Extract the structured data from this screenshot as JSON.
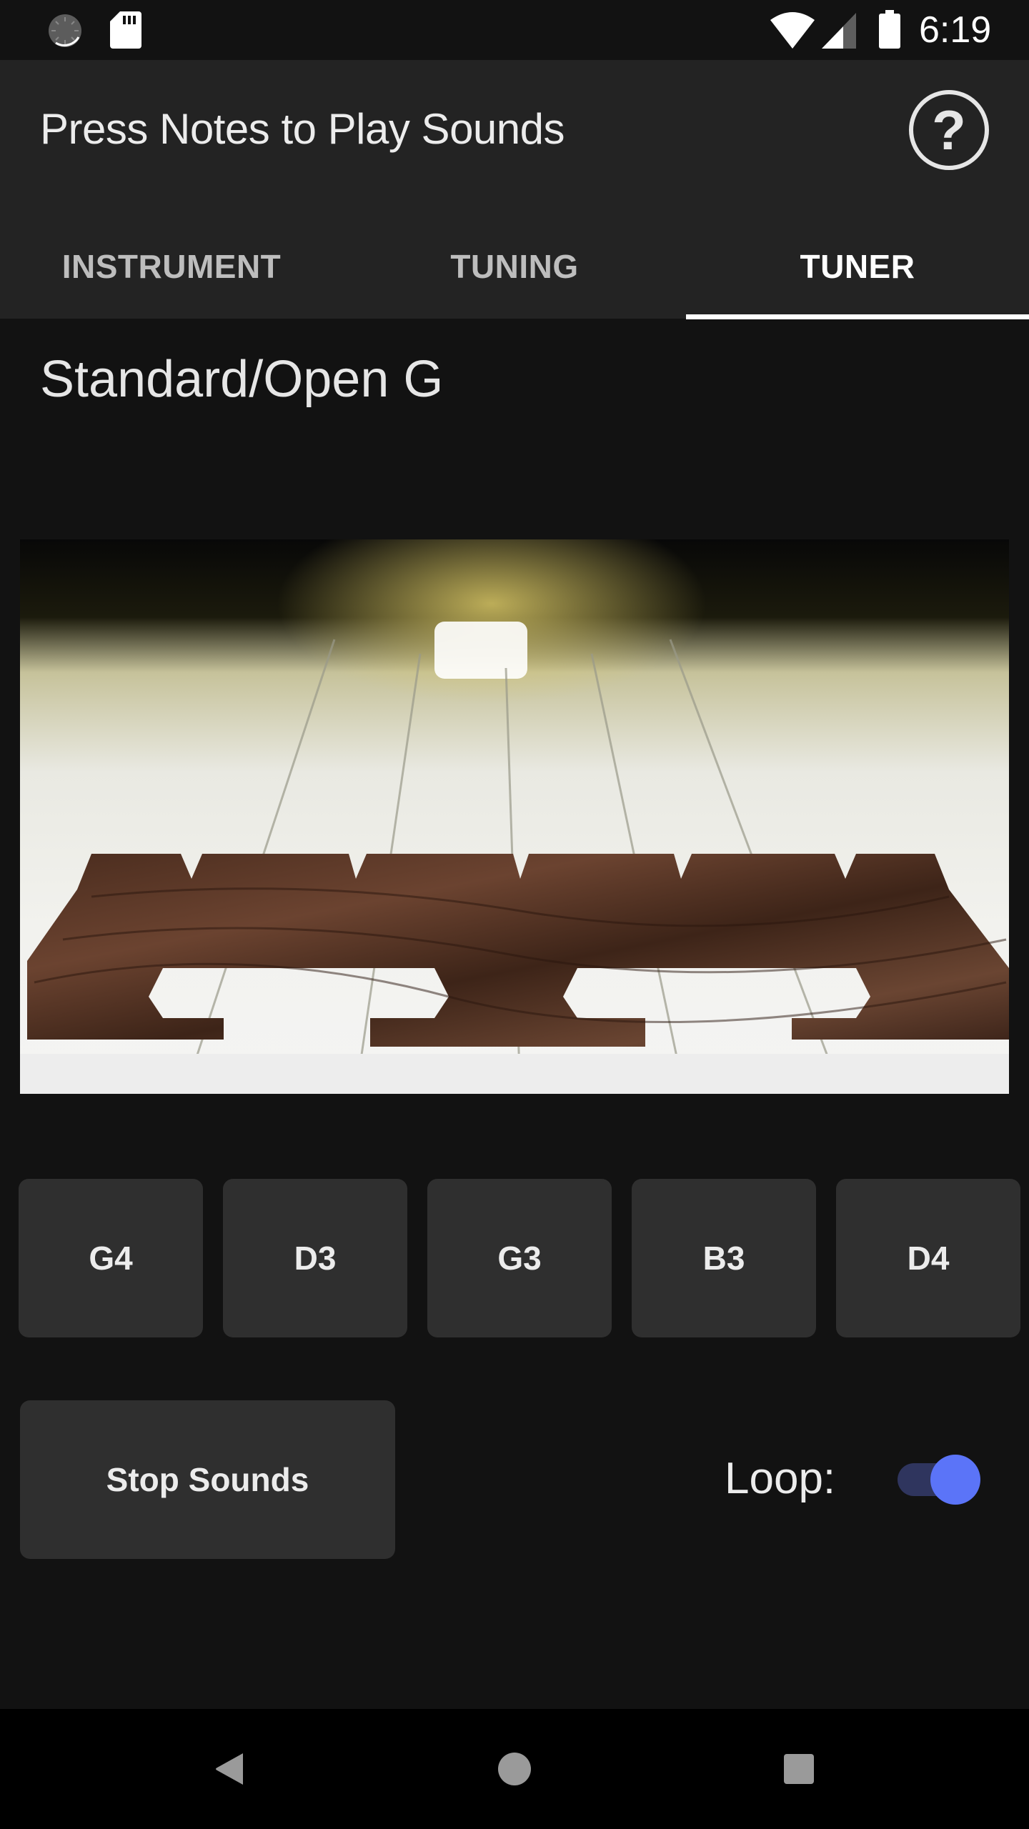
{
  "status_bar": {
    "time": "6:19",
    "left_icons": [
      "sync-progress-icon",
      "sd-card-icon"
    ],
    "right_icons": [
      "wifi-icon",
      "cell-signal-icon",
      "battery-icon"
    ]
  },
  "app_bar": {
    "title": "Press Notes to Play Sounds",
    "help_icon": "help-circle-icon",
    "help_glyph": "?"
  },
  "tabs": [
    {
      "label": "INSTRUMENT",
      "active": false
    },
    {
      "label": "TUNING",
      "active": false
    },
    {
      "label": "TUNER",
      "active": true
    }
  ],
  "tuner": {
    "tuning_name": "Standard/Open G",
    "image_alt": "Close-up of banjo bridge with strings",
    "notes": [
      "G4",
      "D3",
      "G3",
      "B3",
      "D4"
    ],
    "stop_label": "Stop Sounds",
    "loop_label": "Loop:",
    "loop_enabled": true
  },
  "colors": {
    "accent": "#5b74f8",
    "toggle_track": "#2f355e",
    "background": "#121212",
    "app_bar": "#232323",
    "button": "#2f2f2f"
  },
  "nav_bar": {
    "buttons": [
      "back-icon",
      "home-icon",
      "recents-icon"
    ]
  }
}
